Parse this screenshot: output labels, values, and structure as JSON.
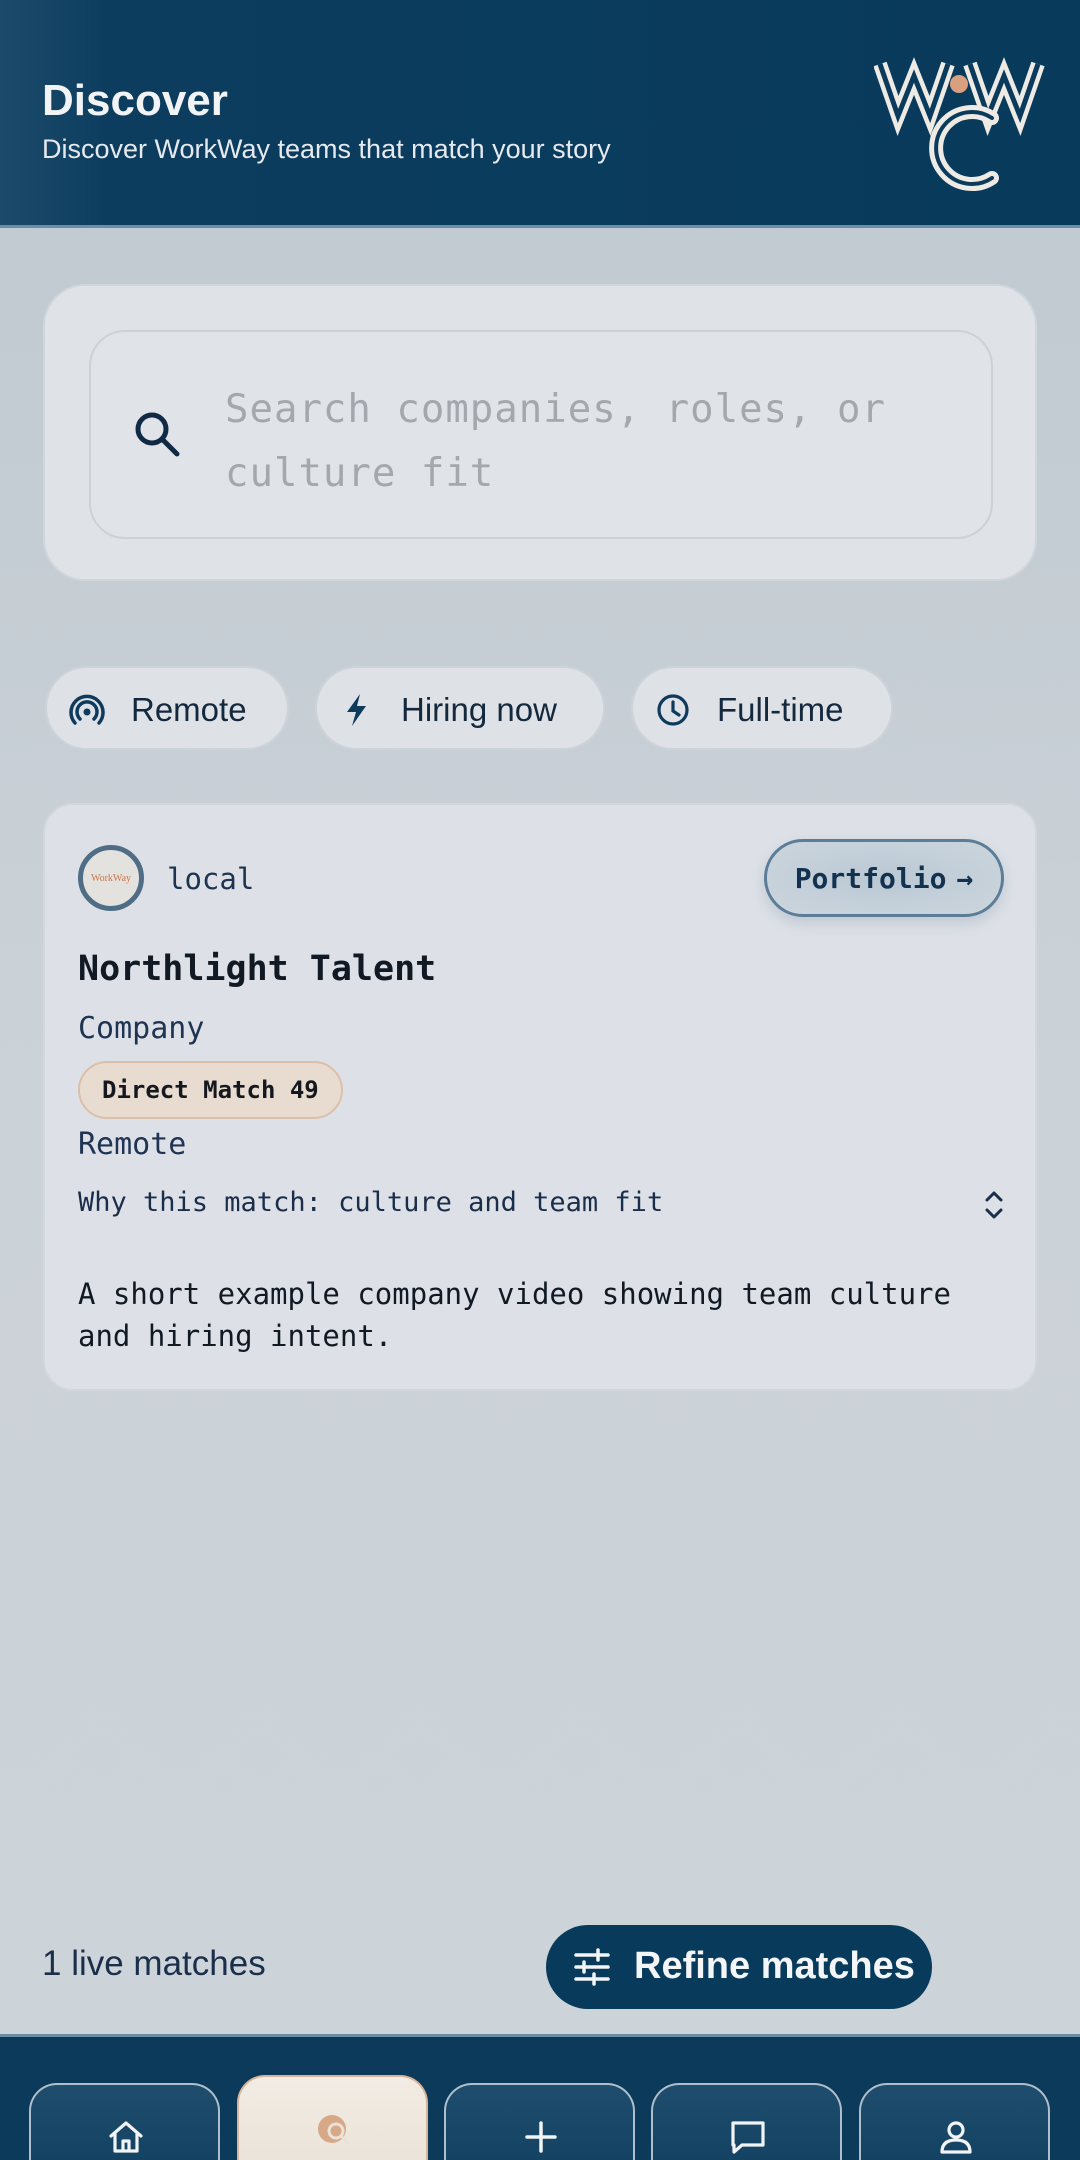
{
  "header": {
    "title": "Discover",
    "subtitle": "Discover WorkWay teams that match your story",
    "logo_letters": "WWC"
  },
  "search": {
    "placeholder": "Search companies, roles, or culture fit"
  },
  "filters": [
    {
      "label": "Remote",
      "icon": "broadcast-icon"
    },
    {
      "label": "Hiring now",
      "icon": "lightning-icon"
    },
    {
      "label": "Full-time",
      "icon": "clock-icon"
    }
  ],
  "match_card": {
    "avatar_text": "WorkWay",
    "source": "local",
    "portfolio_label": "Portfolio",
    "portfolio_arrow": "→",
    "company_name": "Northlight Talent",
    "company_type": "Company",
    "match_badge": "Direct Match 49",
    "location": "Remote",
    "why_match": "Why this match: culture and team fit",
    "description": "A short example company video showing team culture and hiring intent."
  },
  "footer": {
    "live_count": "1 live matches",
    "refine_label": "Refine matches"
  },
  "nav": [
    {
      "icon": "home-icon"
    },
    {
      "icon": "discover-icon",
      "active": true
    },
    {
      "icon": "plus-icon"
    },
    {
      "icon": "chat-icon"
    },
    {
      "icon": "profile-icon"
    }
  ],
  "colors": {
    "primary": "#083a5c",
    "accent": "#d8a07e",
    "background": "#c8d0d6",
    "card": "#dde1e7"
  }
}
